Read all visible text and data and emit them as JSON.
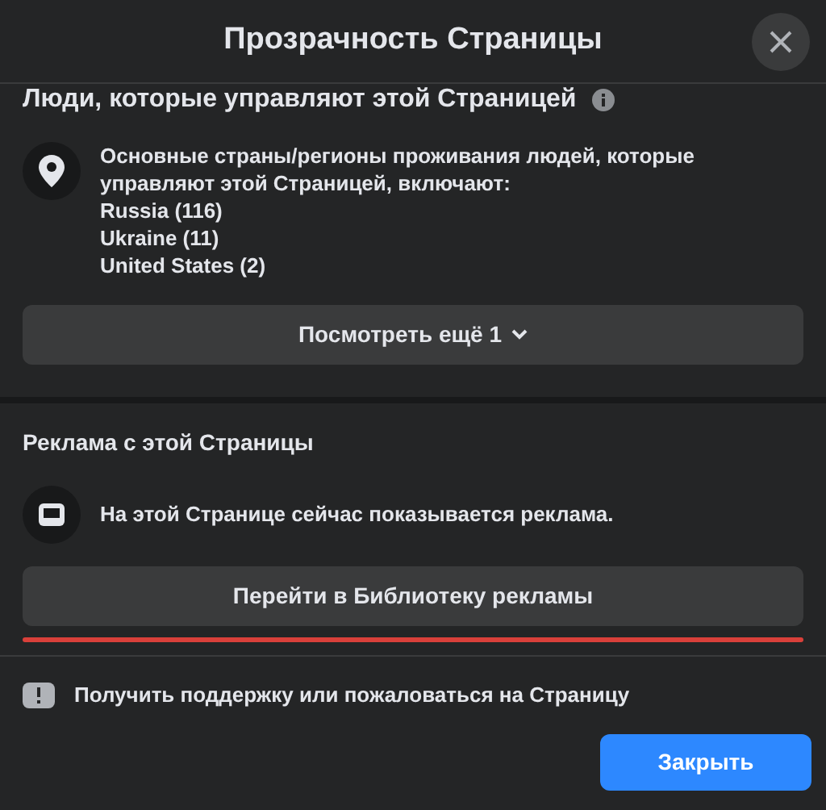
{
  "dialog": {
    "title": "Прозрачность Страницы"
  },
  "managers": {
    "heading": "Люди, которые управляют этой Страницей",
    "description": "Основные страны/регионы проживания людей, которые управляют этой Страницей, включают:",
    "countries": [
      "Russia (116)",
      "Ukraine (11)",
      "United States (2)"
    ],
    "more_button": "Посмотреть ещё 1"
  },
  "ads": {
    "heading": "Реклама с этой Страницы",
    "description": "На этой Странице сейчас показывается реклама.",
    "library_button": "Перейти в Библиотеку рекламы"
  },
  "support_link": "Получить поддержку или пожаловаться на Страницу",
  "close_button": "Закрыть"
}
